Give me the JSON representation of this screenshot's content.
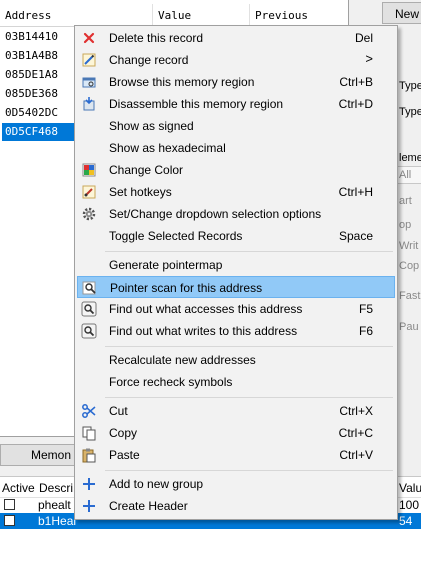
{
  "address_list": {
    "columns": [
      "Address",
      "Value",
      "Previous"
    ],
    "rows": [
      "03B14410",
      "03B1A4B8",
      "085DE1A8",
      "085DE368",
      "0D5402DC",
      "0D5CF468"
    ],
    "selected_row": "0D5CF468"
  },
  "right_panel": {
    "new_button": "New",
    "frag1": "Type",
    "frag2": "Type",
    "frag3": "leme",
    "frag4": "All",
    "frag5": "art",
    "frag6": "op",
    "frag7": "Writ",
    "frag8": "Cop",
    "frag9": "Fast",
    "frag10": "Pau"
  },
  "memory_view_button": "Memon",
  "cheat_table": {
    "columns": [
      "Active",
      "Descri",
      "Valu"
    ],
    "rows": [
      {
        "desc": "phealt",
        "value": "100"
      },
      {
        "desc": "b1Heal",
        "value": "54"
      }
    ]
  },
  "context_menu": {
    "group1": [
      {
        "label": "Delete this record",
        "shortcut": "Del",
        "icon": "red-x-icon"
      },
      {
        "label": "Change record",
        "shortcut": "",
        "submenu": ">",
        "icon": "pencil-icon"
      },
      {
        "label": "Browse this memory region",
        "shortcut": "Ctrl+B",
        "icon": "browse-memory-icon"
      },
      {
        "label": "Disassemble this memory region",
        "shortcut": "Ctrl+D",
        "icon": "disassemble-icon"
      },
      {
        "label": "Show as signed",
        "shortcut": ""
      },
      {
        "label": "Show as hexadecimal",
        "shortcut": ""
      },
      {
        "label": "Change Color",
        "shortcut": "",
        "icon": "color-palette-icon"
      },
      {
        "label": "Set hotkeys",
        "shortcut": "Ctrl+H",
        "icon": "hotkey-icon"
      },
      {
        "label": "Set/Change dropdown selection options",
        "shortcut": "",
        "icon": "gear-icon"
      },
      {
        "label": "Toggle Selected Records",
        "shortcut": "Space"
      }
    ],
    "group2": [
      {
        "label": "Generate pointermap",
        "shortcut": ""
      },
      {
        "label": "Pointer scan for this address",
        "shortcut": "",
        "icon": "magnifier-icon",
        "highlighted": true
      },
      {
        "label": "Find out what accesses this address",
        "shortcut": "F5",
        "icon": "find-access-icon"
      },
      {
        "label": "Find out what writes to this address",
        "shortcut": "F6",
        "icon": "find-write-icon"
      }
    ],
    "group3": [
      {
        "label": "Recalculate new addresses",
        "shortcut": ""
      },
      {
        "label": "Force recheck symbols",
        "shortcut": ""
      }
    ],
    "group4": [
      {
        "label": "Cut",
        "shortcut": "Ctrl+X",
        "icon": "scissors-icon"
      },
      {
        "label": "Copy",
        "shortcut": "Ctrl+C",
        "icon": "copy-icon"
      },
      {
        "label": "Paste",
        "shortcut": "Ctrl+V",
        "icon": "paste-icon"
      }
    ],
    "group5": [
      {
        "label": "Add to new group",
        "shortcut": "",
        "icon": "plus-icon"
      },
      {
        "label": "Create Header",
        "shortcut": "",
        "icon": "plus-icon"
      }
    ]
  },
  "colors": {
    "highlight": "#91c9f7",
    "selection": "#0078d7",
    "menu_bg": "#f2f2f2"
  }
}
